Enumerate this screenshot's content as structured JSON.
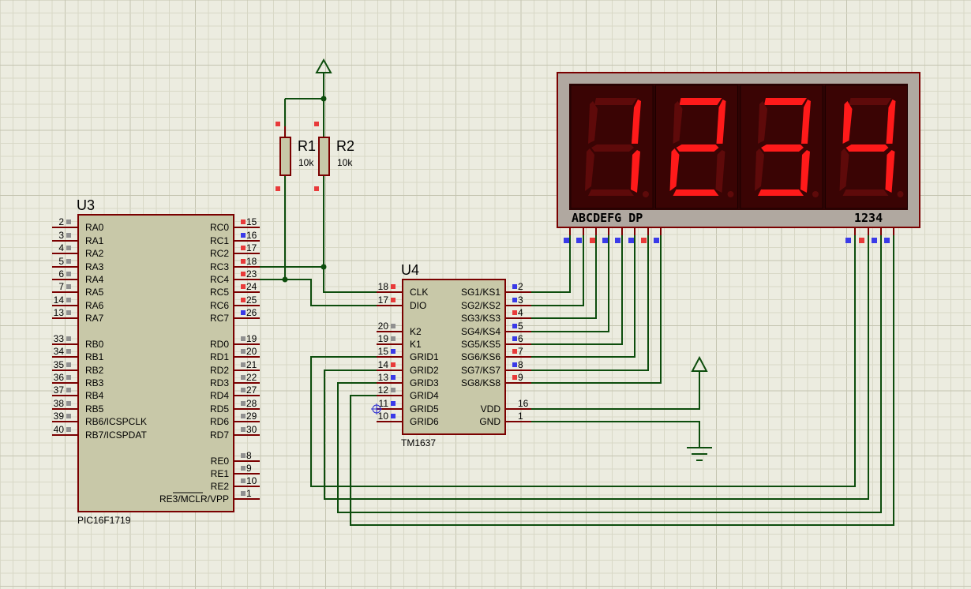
{
  "grid": {
    "minor": 16.5,
    "major": 82.5,
    "minor_color": "#d8d8c6",
    "major_color": "#c4c4b0",
    "background": "#ecece0"
  },
  "colors": {
    "wire": "#0d4d0d",
    "outline": "#7a0000",
    "body": "#c8c8a8",
    "pin_red": "#e83a3a",
    "pin_blue": "#3a3ae8",
    "pin_gray": "#909090",
    "seg_on": "#ff1a1a",
    "seg_off": "#5e0a0a"
  },
  "u3": {
    "ref": "U3",
    "part": "PIC16F1719",
    "left_pins": [
      {
        "num": "2",
        "name": "RA0",
        "dot": "gray"
      },
      {
        "num": "3",
        "name": "RA1",
        "dot": "gray"
      },
      {
        "num": "4",
        "name": "RA2",
        "dot": "gray"
      },
      {
        "num": "5",
        "name": "RA3",
        "dot": "gray"
      },
      {
        "num": "6",
        "name": "RA4",
        "dot": "gray"
      },
      {
        "num": "7",
        "name": "RA5",
        "dot": "gray"
      },
      {
        "num": "14",
        "name": "RA6",
        "dot": "gray"
      },
      {
        "num": "13",
        "name": "RA7",
        "dot": "gray"
      },
      {
        "num": "33",
        "name": "RB0",
        "dot": "gray"
      },
      {
        "num": "34",
        "name": "RB1",
        "dot": "gray"
      },
      {
        "num": "35",
        "name": "RB2",
        "dot": "gray"
      },
      {
        "num": "36",
        "name": "RB3",
        "dot": "gray"
      },
      {
        "num": "37",
        "name": "RB4",
        "dot": "gray"
      },
      {
        "num": "38",
        "name": "RB5",
        "dot": "gray"
      },
      {
        "num": "39",
        "name": "RB6/ICSPCLK",
        "dot": "gray"
      },
      {
        "num": "40",
        "name": "RB7/ICSPDAT",
        "dot": "gray"
      }
    ],
    "right_pins": [
      {
        "num": "15",
        "name": "RC0",
        "dot": "red"
      },
      {
        "num": "16",
        "name": "RC1",
        "dot": "blue"
      },
      {
        "num": "17",
        "name": "RC2",
        "dot": "red"
      },
      {
        "num": "18",
        "name": "RC3",
        "dot": "red"
      },
      {
        "num": "23",
        "name": "RC4",
        "dot": "red"
      },
      {
        "num": "24",
        "name": "RC5",
        "dot": "red"
      },
      {
        "num": "25",
        "name": "RC6",
        "dot": "red"
      },
      {
        "num": "26",
        "name": "RC7",
        "dot": "blue"
      },
      {
        "num": "19",
        "name": "RD0",
        "dot": "gray"
      },
      {
        "num": "20",
        "name": "RD1",
        "dot": "gray"
      },
      {
        "num": "21",
        "name": "RD2",
        "dot": "gray"
      },
      {
        "num": "22",
        "name": "RD3",
        "dot": "gray"
      },
      {
        "num": "27",
        "name": "RD4",
        "dot": "gray"
      },
      {
        "num": "28",
        "name": "RD5",
        "dot": "gray"
      },
      {
        "num": "29",
        "name": "RD6",
        "dot": "gray"
      },
      {
        "num": "30",
        "name": "RD7",
        "dot": "gray"
      },
      {
        "num": "8",
        "name": "RE0",
        "dot": "gray"
      },
      {
        "num": "9",
        "name": "RE1",
        "dot": "gray"
      },
      {
        "num": "10",
        "name": "RE2",
        "dot": "gray"
      },
      {
        "num": "1",
        "name": "RE3/MCLR/VPP",
        "dot": "gray"
      }
    ]
  },
  "u4": {
    "ref": "U4",
    "part": "TM1637",
    "left_pins": [
      {
        "num": "18",
        "name": "CLK",
        "dot": "red"
      },
      {
        "num": "17",
        "name": "DIO",
        "dot": "red"
      },
      {
        "num": "20",
        "name": "K2",
        "dot": "gray"
      },
      {
        "num": "19",
        "name": "K1",
        "dot": "gray"
      },
      {
        "num": "15",
        "name": "GRID1",
        "dot": "blue"
      },
      {
        "num": "14",
        "name": "GRID2",
        "dot": "red"
      },
      {
        "num": "13",
        "name": "GRID3",
        "dot": "blue"
      },
      {
        "num": "12",
        "name": "GRID4",
        "dot": "gray"
      },
      {
        "num": "11",
        "name": "GRID5",
        "dot": "blue"
      },
      {
        "num": "10",
        "name": "GRID6",
        "dot": "blue"
      }
    ],
    "right_pins": [
      {
        "num": "2",
        "name": "SG1/KS1",
        "dot": "blue"
      },
      {
        "num": "3",
        "name": "SG2/KS2",
        "dot": "blue"
      },
      {
        "num": "4",
        "name": "SG3/KS3",
        "dot": "red"
      },
      {
        "num": "5",
        "name": "SG4/KS4",
        "dot": "blue"
      },
      {
        "num": "6",
        "name": "SG5/KS5",
        "dot": "blue"
      },
      {
        "num": "7",
        "name": "SG6/KS6",
        "dot": "red"
      },
      {
        "num": "8",
        "name": "SG7/KS7",
        "dot": "blue"
      },
      {
        "num": "9",
        "name": "SG8/KS8",
        "dot": "red"
      },
      {
        "num": "16",
        "name": "VDD",
        "dot": "none"
      },
      {
        "num": "1",
        "name": "GND",
        "dot": "none"
      }
    ]
  },
  "r1": {
    "ref": "R1",
    "value": "10k"
  },
  "r2": {
    "ref": "R2",
    "value": "10k"
  },
  "display": {
    "segment_label": "ABCDEFG DP",
    "digit_label": "1234",
    "digits": [
      "1",
      "2",
      "3",
      "4"
    ],
    "bottom_dots": [
      "blue",
      "blue",
      "red",
      "blue",
      "blue",
      "blue",
      "red",
      "blue",
      "red",
      "red"
    ],
    "digit_dots": [
      "blue",
      "red",
      "blue",
      "blue"
    ]
  }
}
